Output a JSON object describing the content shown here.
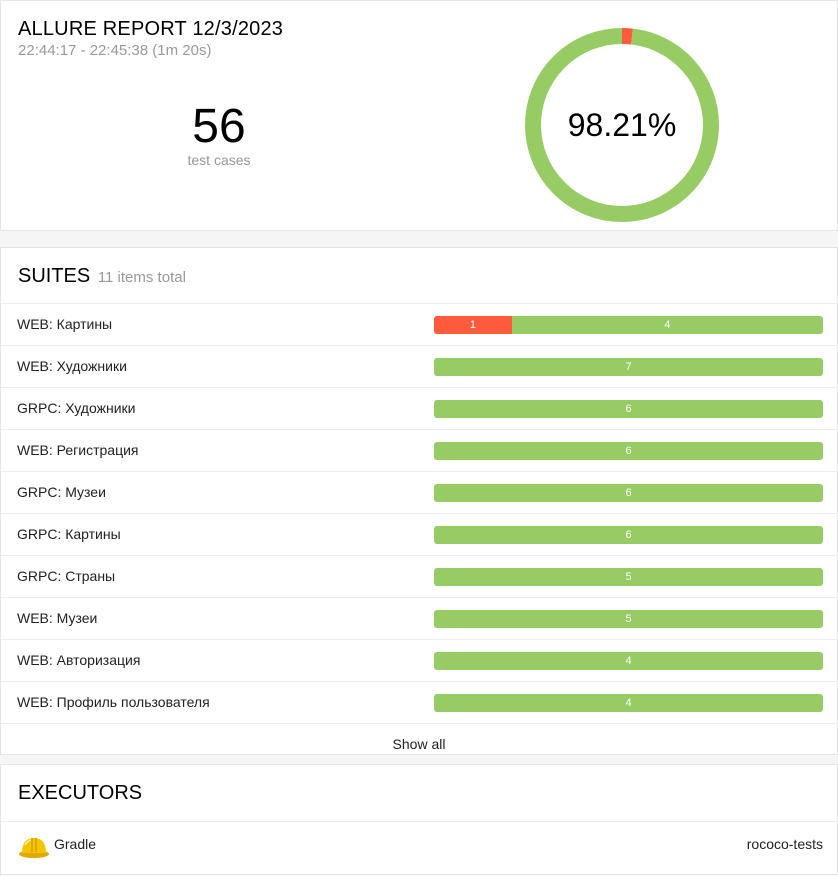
{
  "report": {
    "title": "ALLURE REPORT 12/3/2023",
    "time_range": "22:44:17 - 22:45:38 (1m 20s)"
  },
  "summary": {
    "count": "56",
    "count_label": "test cases",
    "percent_text": "98.21%",
    "passed_fraction": 0.9821,
    "failed_fraction": 0.0179
  },
  "colors": {
    "passed": "#97cc64",
    "failed": "#fd5a3e"
  },
  "suites": {
    "title": "SUITES",
    "count_text": "11 items total",
    "items": [
      {
        "name": "WEB: Картины",
        "failed": 1,
        "passed": 4,
        "failed_label": "1",
        "passed_label": "4"
      },
      {
        "name": "WEB: Художники",
        "failed": 0,
        "passed": 7,
        "failed_label": "",
        "passed_label": "7"
      },
      {
        "name": "GRPC: Художники",
        "failed": 0,
        "passed": 6,
        "failed_label": "",
        "passed_label": "6"
      },
      {
        "name": "WEB: Регистрация",
        "failed": 0,
        "passed": 6,
        "failed_label": "",
        "passed_label": "6"
      },
      {
        "name": "GRPC: Музеи",
        "failed": 0,
        "passed": 6,
        "failed_label": "",
        "passed_label": "6"
      },
      {
        "name": "GRPC: Картины",
        "failed": 0,
        "passed": 6,
        "failed_label": "",
        "passed_label": "6"
      },
      {
        "name": "GRPC: Страны",
        "failed": 0,
        "passed": 5,
        "failed_label": "",
        "passed_label": "5"
      },
      {
        "name": "WEB: Музеи",
        "failed": 0,
        "passed": 5,
        "failed_label": "",
        "passed_label": "5"
      },
      {
        "name": "WEB: Авторизация",
        "failed": 0,
        "passed": 4,
        "failed_label": "",
        "passed_label": "4"
      },
      {
        "name": "WEB: Профиль пользователя",
        "failed": 0,
        "passed": 4,
        "failed_label": "",
        "passed_label": "4"
      }
    ],
    "show_all": "Show all"
  },
  "executors": {
    "title": "EXECUTORS",
    "icon": "hard-hat-icon",
    "name": "Gradle",
    "build": "rococo-tests"
  }
}
